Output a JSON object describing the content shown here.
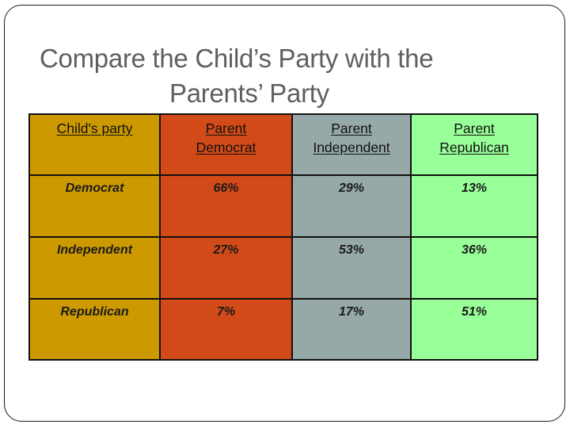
{
  "slide": {
    "title_line1": "Compare the Child’s Party with the",
    "title_line2": "Parents’ Party"
  },
  "colors": {
    "child_column": "#CC9900",
    "parent_democrat": "#D24A17",
    "parent_independent": "#96A8A8",
    "parent_republican": "#99FF99",
    "title_text": "#5f5f5f"
  },
  "table": {
    "headers": [
      {
        "line1": "Child's party",
        "line2": ""
      },
      {
        "line1": "Parent",
        "line2": "Democrat"
      },
      {
        "line1": "Parent",
        "line2": "Independent"
      },
      {
        "line1": "Parent",
        "line2": "Republican"
      }
    ],
    "rows": [
      {
        "label": "Democrat",
        "values": [
          "66%",
          "29%",
          "13%"
        ]
      },
      {
        "label": "Independent",
        "values": [
          "27%",
          "53%",
          "36%"
        ]
      },
      {
        "label": "Republican",
        "values": [
          "7%",
          "17%",
          "51%"
        ]
      }
    ]
  }
}
